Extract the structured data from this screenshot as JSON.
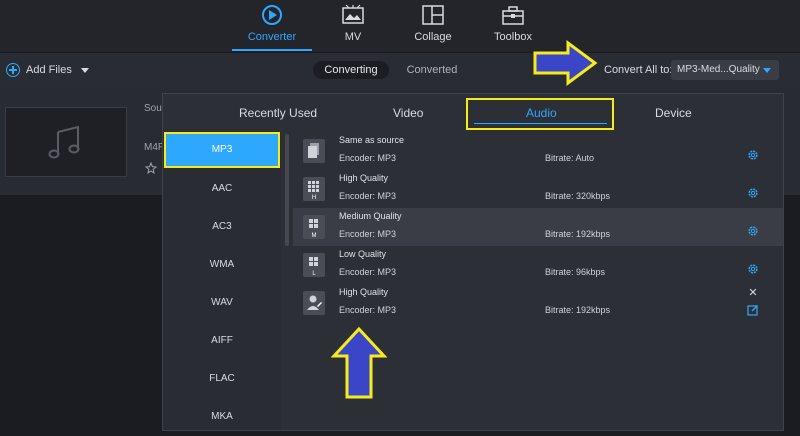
{
  "nav": {
    "items": [
      {
        "label": "Converter",
        "icon": "converter-icon",
        "active": true
      },
      {
        "label": "MV",
        "icon": "mv-icon",
        "active": false
      },
      {
        "label": "Collage",
        "icon": "collage-icon",
        "active": false
      },
      {
        "label": "Toolbox",
        "icon": "toolbox-icon",
        "active": false
      }
    ]
  },
  "toolbar": {
    "add_files": "Add Files",
    "seg_converting": "Converting",
    "seg_converted": "Converted",
    "convert_all_label": "Convert All to:",
    "convert_all_value": "MP3-Med...Quality"
  },
  "file": {
    "source_partial": "Sou",
    "format_partial": "M4F"
  },
  "popup": {
    "tabs": [
      "Recently Used",
      "Video",
      "Audio",
      "Device"
    ],
    "active_tab": "Audio",
    "formats": [
      "MP3",
      "AAC",
      "AC3",
      "WMA",
      "WAV",
      "AIFF",
      "FLAC",
      "MKA"
    ],
    "selected_format": "MP3",
    "presets": [
      {
        "name": "Same as source",
        "encoder": "Encoder: MP3",
        "bitrate": "Bitrate: Auto",
        "badge": "",
        "action": "gear"
      },
      {
        "name": "High Quality",
        "encoder": "Encoder: MP3",
        "bitrate": "Bitrate: 320kbps",
        "badge": "H",
        "action": "gear"
      },
      {
        "name": "Medium Quality",
        "encoder": "Encoder: MP3",
        "bitrate": "Bitrate: 192kbps",
        "badge": "M",
        "action": "gear"
      },
      {
        "name": "Low Quality",
        "encoder": "Encoder: MP3",
        "bitrate": "Bitrate: 96kbps",
        "badge": "L",
        "action": "gear"
      },
      {
        "name": "High Quality",
        "encoder": "Encoder: MP3",
        "bitrate": "Bitrate: 192kbps",
        "badge": "",
        "action": "edit"
      }
    ]
  },
  "colors": {
    "accent": "#2ea8ff",
    "highlight": "#f6ec1c",
    "annotation_arrow": "#3b45c8"
  }
}
